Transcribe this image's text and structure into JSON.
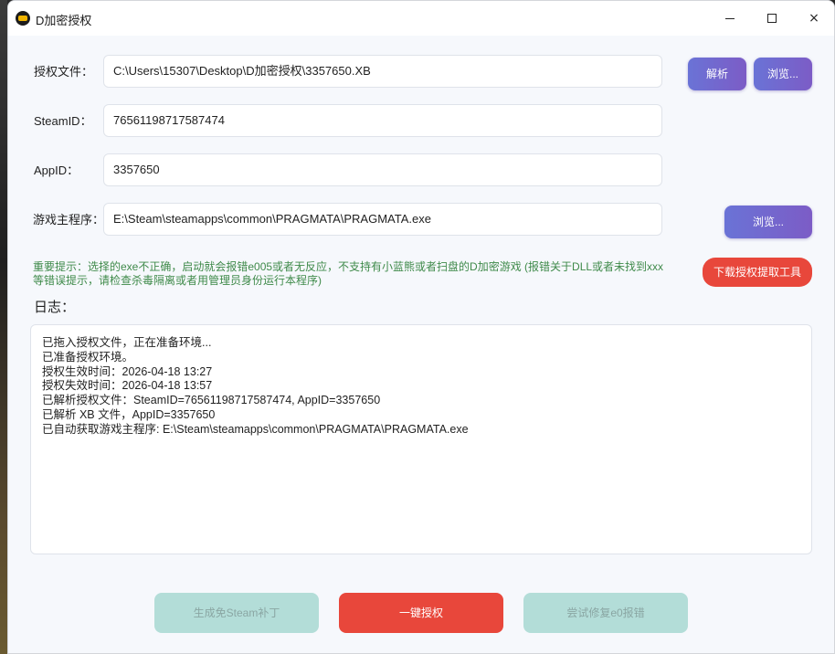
{
  "window": {
    "title": "D加密授权",
    "controls": {
      "minimize": "minimize",
      "maximize": "maximize",
      "close": "×"
    }
  },
  "form": {
    "license_file": {
      "label": "授权文件：",
      "value": "C:\\Users\\15307\\Desktop\\D加密授权\\3357650.XB"
    },
    "steam_id": {
      "label": "SteamID：",
      "value": "76561198717587474"
    },
    "app_id": {
      "label": "AppID：",
      "value": "3357650"
    },
    "game_exe": {
      "label": "游戏主程序：",
      "value": "E:\\Steam\\steamapps\\common\\PRAGMATA\\PRAGMATA.exe"
    }
  },
  "buttons": {
    "parse": "解析",
    "browse_license": "浏览...",
    "browse_exe": "浏览...",
    "download_tool": "下载授权提取工具",
    "gen_patch": "生成免Steam补丁",
    "one_click": "一键授权",
    "fix_e0": "尝试修复e0报错"
  },
  "warning": {
    "line1": "重要提示：选择的exe不正确，启动就会报错e005或者无反应，不支持有小蓝熊或者扫盘的D加密游戏 (报错关于DLL或者未找到xxx",
    "line2": "等错误提示，请检查杀毒隔离或者用管理员身份运行本程序)"
  },
  "log": {
    "title": "日志：",
    "lines": [
      "已拖入授权文件，正在准备环境...",
      "已准备授权环境。",
      "授权生效时间：2026-04-18 13:27",
      "授权失效时间：2026-04-18 13:57",
      "已解析授权文件：SteamID=76561198717587474, AppID=3357650",
      "已解析 XB 文件，AppID=3357650",
      "已自动获取游戏主程序: E:\\Steam\\steamapps\\common\\PRAGMATA\\PRAGMATA.exe"
    ]
  },
  "colors": {
    "accent_purple": "#6a73d6",
    "accent_red": "#e8473b",
    "disabled_teal": "#b3ddd8",
    "warning_green": "#3f8a4a"
  }
}
